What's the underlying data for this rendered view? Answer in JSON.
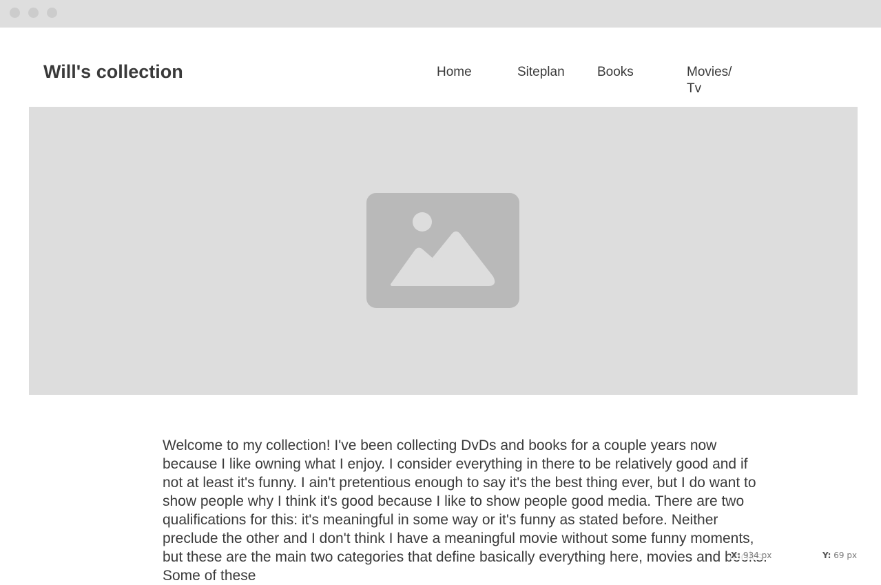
{
  "window": {
    "controls": [
      "close",
      "minimize",
      "maximize"
    ]
  },
  "header": {
    "site_title": "Will's collection",
    "nav": [
      {
        "label": "Home"
      },
      {
        "label": "Siteplan"
      },
      {
        "label": "Books"
      },
      {
        "label": "Movies/\nTv"
      }
    ]
  },
  "hero": {
    "icon": "image-placeholder-icon"
  },
  "main": {
    "intro": "Welcome to my collection! I've been collecting DvDs and books for a couple years now because I like owning what I enjoy. I consider everything in there to be relatively good and if not at least it's funny. I ain't pretentious enough to say it's the best thing ever, but I do want to show people why I think it's good because I like to show people good media. There are two qualifications for this: it's meaningful in some way or it's funny as stated before. Neither preclude the other and I don't think I have a meaningful movie without some funny moments, but these are the main two categories that define basically everything here, movies and books. Some of these"
  },
  "cursor_readout": {
    "x_label": "X:",
    "x_value": "934 px",
    "y_label": "Y:",
    "y_value": "69 px"
  },
  "colors": {
    "titlebar": "#dedede",
    "hero_bg": "#dddddd",
    "placeholder_icon": "#b9b9b9",
    "text": "#3a3a3a"
  }
}
